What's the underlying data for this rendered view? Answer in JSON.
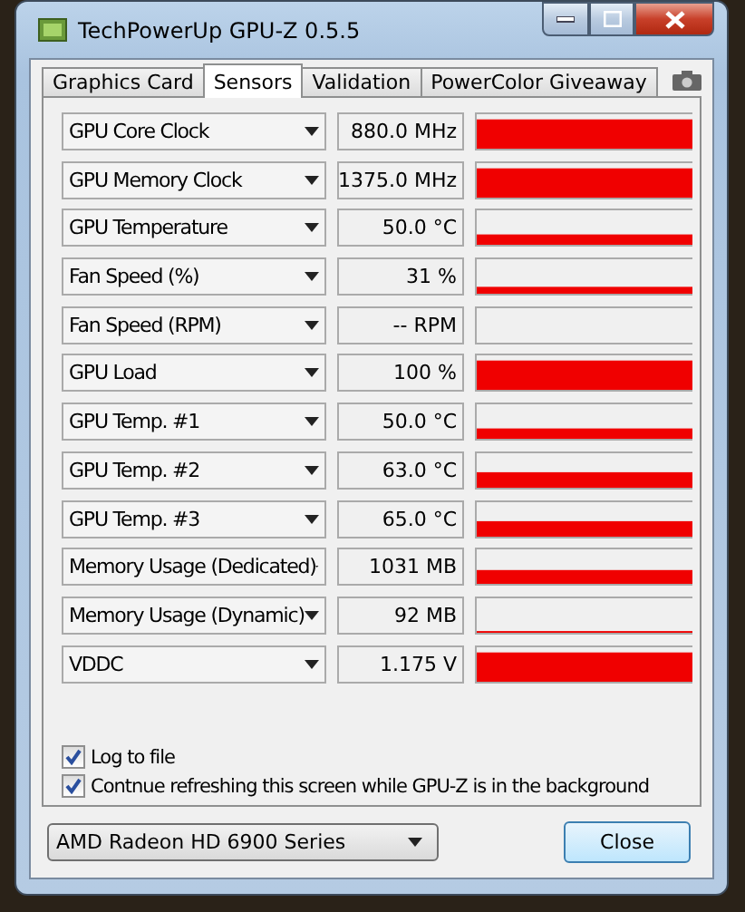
{
  "window": {
    "title": "TechPowerUp GPU-Z 0.5.5"
  },
  "tabs": [
    {
      "label": "Graphics Card",
      "selected": false
    },
    {
      "label": "Sensors",
      "selected": true
    },
    {
      "label": "Validation",
      "selected": false
    },
    {
      "label": "PowerColor Giveaway",
      "selected": false
    }
  ],
  "sensors": [
    {
      "name": "GPU Core Clock",
      "value": "880.0 MHz"
    },
    {
      "name": "GPU Memory Clock",
      "value": "1375.0 MHz"
    },
    {
      "name": "GPU Temperature",
      "value": "50.0 °C"
    },
    {
      "name": "Fan Speed (%)",
      "value": "31 %"
    },
    {
      "name": "Fan Speed (RPM)",
      "value": "-- RPM"
    },
    {
      "name": "GPU Load",
      "value": "100 %"
    },
    {
      "name": "GPU Temp. #1",
      "value": "50.0 °C"
    },
    {
      "name": "GPU Temp. #2",
      "value": "63.0 °C"
    },
    {
      "name": "GPU Temp. #3",
      "value": "65.0 °C"
    },
    {
      "name": "Memory Usage (Dedicated)",
      "value": "1031 MB"
    },
    {
      "name": "Memory Usage (Dynamic)",
      "value": "92 MB"
    },
    {
      "name": "VDDC",
      "value": "1.175 V"
    }
  ],
  "options": [
    {
      "label": "Log to file",
      "checked": true
    },
    {
      "label": "Contnue refreshing this screen while GPU-Z is in the background",
      "checked": true
    }
  ],
  "device": {
    "value": "AMD Radeon HD 6900 Series"
  },
  "close_button": "Close"
}
